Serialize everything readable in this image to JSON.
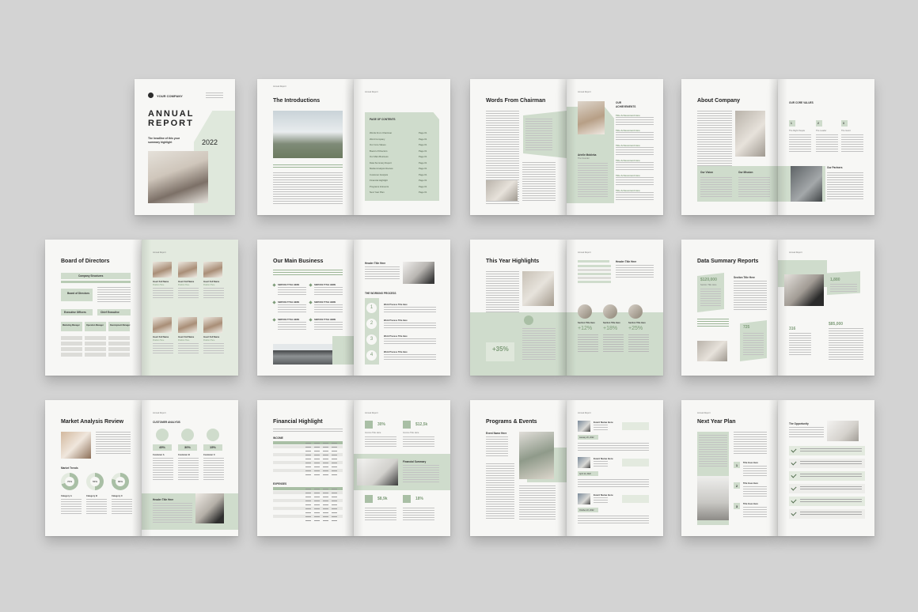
{
  "cover": {
    "company": "YOUR COMPANY",
    "title_1": "ANNUAL",
    "title_2": "REPORT",
    "headline_1": "The headline of this your",
    "headline_2": "summary highlight",
    "year": "2022",
    "running_head": "Annual Report"
  },
  "spreads": [
    {
      "title": "The Introductions",
      "right_heading": "PAGE OF CONTENTS",
      "toc": [
        "Words From Chairman",
        "Word Company",
        "Our Core Values",
        "Board of Directors",
        "Our Main Business",
        "Data Summary Report",
        "Market Analysis Review",
        "Customer Analysis",
        "Financial Highlight",
        "Programs & Events",
        "Next Year Plan"
      ],
      "toc_page": "Page 01"
    },
    {
      "title": "Words From Chairman",
      "right_heading_1": "OUR",
      "right_heading_2": "ACHIEVEMENTS",
      "person_name": "Arielle Mobleka",
      "person_role": "The Founder",
      "item": "Title Achievement Here"
    },
    {
      "title": "About Company",
      "right_heading": "OUR CORE VALUES",
      "vision": "Our Vision",
      "mission": "Our Mission",
      "partners": "Our Partners",
      "value_label": "The Right People",
      "value_label_2": "The Leader",
      "value_label_3": "The Good",
      "nums": [
        "1",
        "2",
        "3"
      ]
    },
    {
      "title": "Board of Directors",
      "structure": "Company Structures",
      "box_board": "Board of Directors",
      "box_exec": "Executive Officers",
      "box_ceo": "Chief Executive",
      "dept": [
        "Marketing Manager",
        "Operation Manager",
        "Development Manager"
      ],
      "names": "Insert Full Name",
      "role": "Position Here"
    },
    {
      "title": "Our Main Business",
      "service": "SERVICE TITLE HERE",
      "header_title": "Header Title Here",
      "process": "THE WORKING PROCESS",
      "steps": [
        "1",
        "2",
        "3",
        "4"
      ],
      "step_title": "Work Process Title Here"
    },
    {
      "title": "This Year Highlights",
      "header_title": "Header Title Here",
      "pct_main": "+35%",
      "pcts": [
        "+12%",
        "+18%",
        "+25%"
      ],
      "section_title": "Section Title Here"
    },
    {
      "title": "Data Summary Reports",
      "vals_left": [
        "$120,000",
        "725"
      ],
      "vals_right": [
        "1,250",
        "1,880",
        "316",
        "$85,000"
      ],
      "section_title": "Section Title Here"
    },
    {
      "title": "Market Analysis Review",
      "right_heading": "CUSTOMER ANALYSIS",
      "pcts": [
        "45%",
        "30%",
        "15%"
      ],
      "customers": [
        "Customer A",
        "Customer B",
        "Customer C"
      ],
      "trends": "Market Trends",
      "donuts": [
        "70%",
        "50%",
        "80%"
      ],
      "categories": [
        "Category A",
        "Category B",
        "Category C"
      ],
      "header_title": "Header Title Here"
    },
    {
      "title": "Financial Highlight",
      "income": "INCOME",
      "expenses": "EXPENSES",
      "stats": [
        "30%",
        "$12,5k",
        "$8,9k",
        "18%"
      ],
      "summary": "Financial Summary",
      "stat_label": "Income Title Here"
    },
    {
      "title": "Programs & Events",
      "event": "Event Name Here",
      "dates": [
        "January 20, 2022",
        "April 12, 2022",
        "October 22, 2022"
      ]
    },
    {
      "title": "Next Year Plan",
      "opportunity": "The Opportunity",
      "steps": [
        "1",
        "2",
        "3"
      ],
      "step_title": "Title Goes Here"
    }
  ],
  "colors": {
    "accent": "#cfdccc",
    "accent_dark": "#a9bfa5",
    "number": "#7e9c79",
    "background": "#d3d3d3",
    "paper": "#f7f7f5"
  }
}
